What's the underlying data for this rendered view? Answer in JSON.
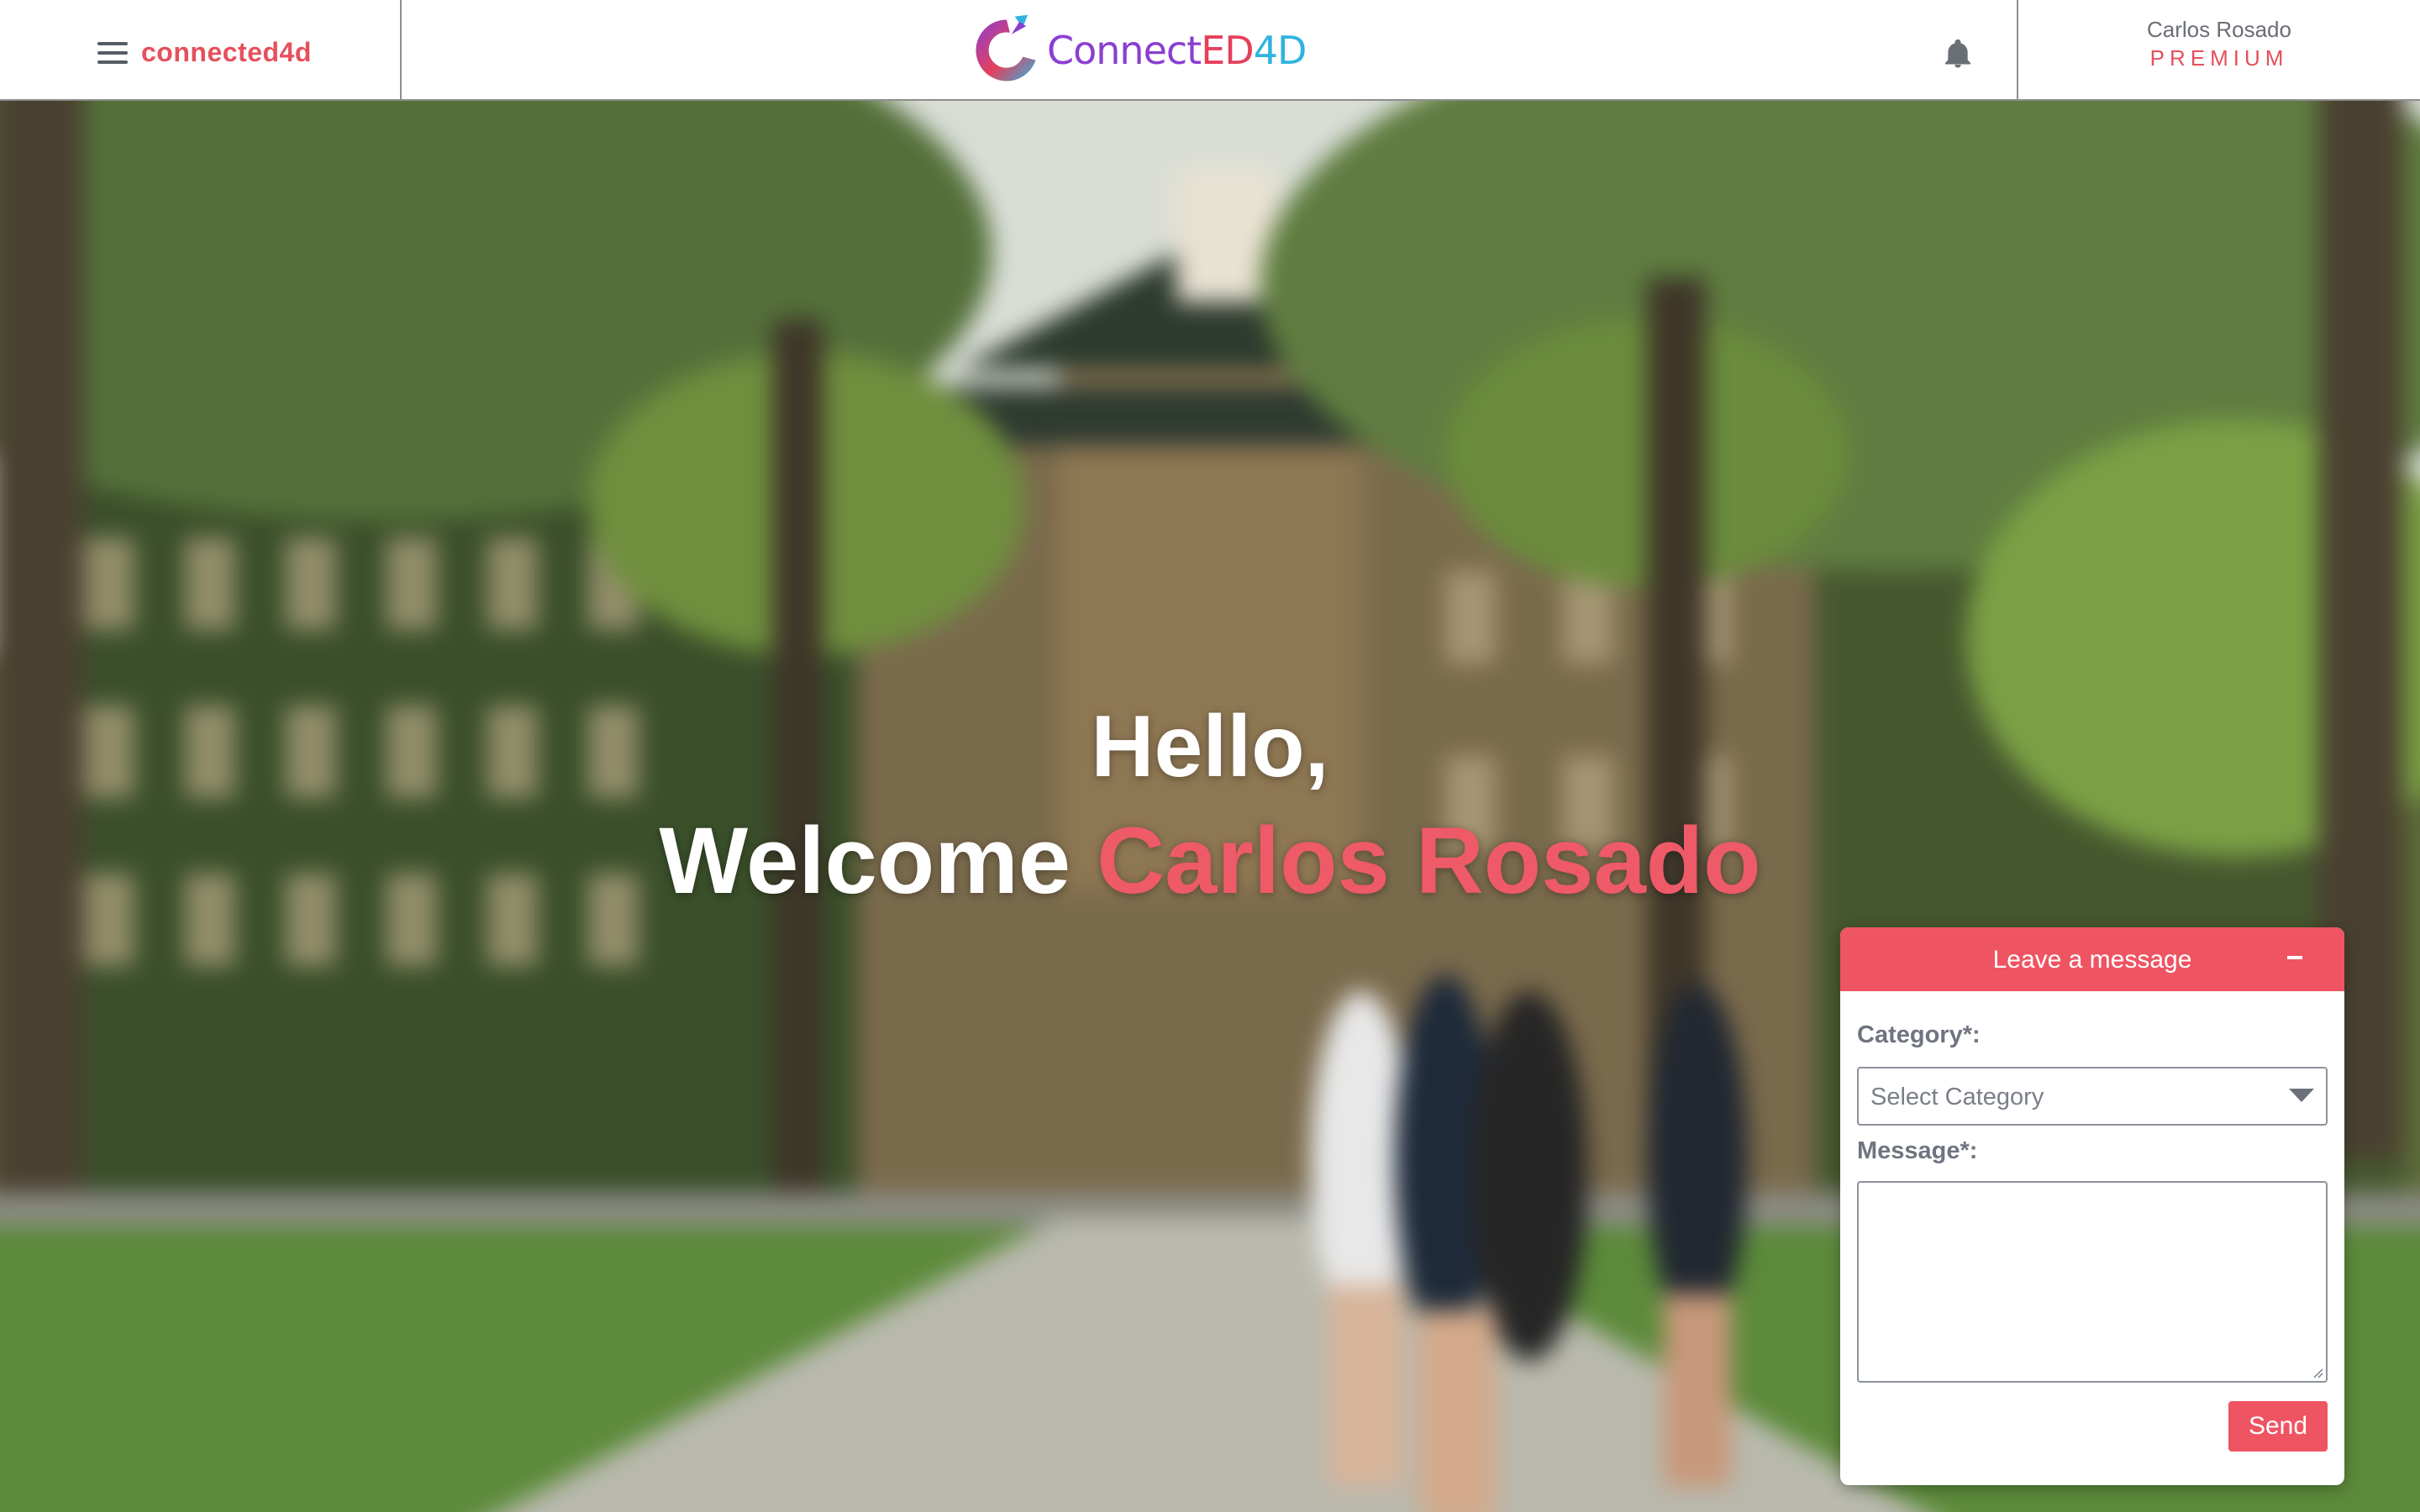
{
  "header": {
    "menu_label": "connected4d",
    "logo": {
      "part1": "Connect",
      "part2": "ED",
      "part3": "4D",
      "colors": {
        "part1": "#8a3fd1",
        "part2": "#e5405c",
        "part3": "#2fb3e0"
      }
    },
    "notification_icon": "bell-icon",
    "user": {
      "name": "Carlos Rosado",
      "tier": "PREMIUM"
    }
  },
  "hero": {
    "greeting": "Hello,",
    "welcome_prefix": "Welcome",
    "welcome_name": "Carlos Rosado"
  },
  "message_widget": {
    "title": "Leave a message",
    "minimize_icon": "minimize-icon",
    "category_label": "Category*:",
    "category_placeholder": "Select Category",
    "message_label": "Message*:",
    "message_value": "",
    "send_label": "Send"
  },
  "theme": {
    "accent": "#ef5462",
    "text_muted": "#6f7480",
    "header_bg": "#ffffff"
  }
}
